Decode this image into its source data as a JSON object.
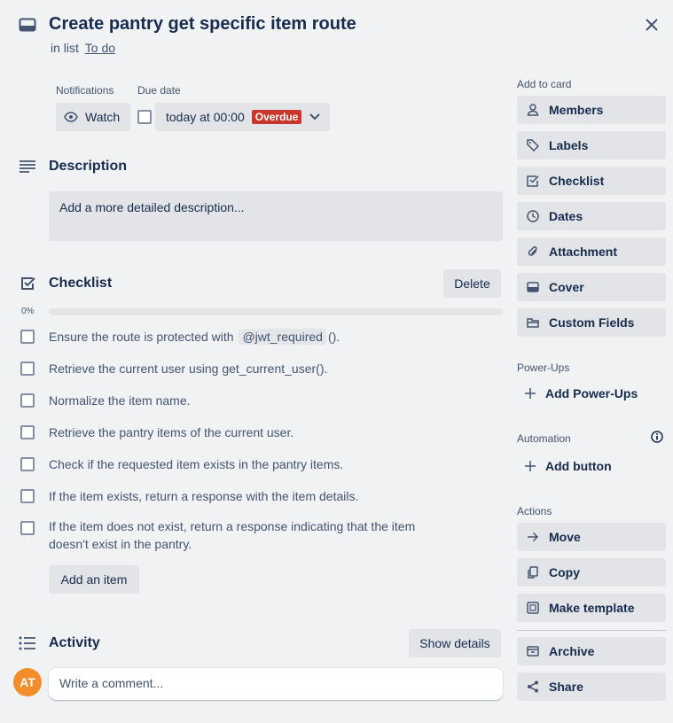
{
  "card": {
    "title": "Create pantry get specific item route",
    "in_list_prefix": "in list",
    "list_name": "To do"
  },
  "notifications": {
    "label": "Notifications",
    "watch_label": "Watch"
  },
  "due": {
    "label": "Due date",
    "value": "today at 00:00",
    "badge": "Overdue",
    "badge_color": "#c9372c"
  },
  "description": {
    "heading": "Description",
    "placeholder": "Add a more detailed description..."
  },
  "checklist": {
    "heading": "Checklist",
    "delete_label": "Delete",
    "progress_text": "0%",
    "progress": 0,
    "items": [
      {
        "before": "Ensure the route is protected with",
        "code": "@jwt_required",
        "after": "()."
      },
      {
        "text": "Retrieve the current user using get_current_user()."
      },
      {
        "text": "Normalize the item name."
      },
      {
        "text": "Retrieve the pantry items of the current user."
      },
      {
        "text": "Check if the requested item exists in the pantry items."
      },
      {
        "text": "If the item exists, return a response with the item details."
      },
      {
        "line1": "If the item does not exist, return a response indicating that the item",
        "line2": "doesn't exist in the pantry."
      }
    ],
    "add_item_label": "Add an item"
  },
  "activity": {
    "heading": "Activity",
    "show_details_label": "Show details",
    "avatar_initials": "AT",
    "avatar_color": "#f38c2b",
    "comment_placeholder": "Write a comment..."
  },
  "sidebar": {
    "add_to_card_label": "Add to card",
    "add_to_card": [
      {
        "label": "Members",
        "icon": "person-icon"
      },
      {
        "label": "Labels",
        "icon": "tag-icon"
      },
      {
        "label": "Checklist",
        "icon": "checklist-icon"
      },
      {
        "label": "Dates",
        "icon": "clock-icon"
      },
      {
        "label": "Attachment",
        "icon": "paperclip-icon"
      },
      {
        "label": "Cover",
        "icon": "cover-icon"
      },
      {
        "label": "Custom Fields",
        "icon": "custom-fields-icon"
      }
    ],
    "power_ups_label": "Power-Ups",
    "add_power_ups_label": "Add Power-Ups",
    "automation_label": "Automation",
    "add_button_label": "Add button",
    "actions_label": "Actions",
    "actions": [
      {
        "label": "Move",
        "icon": "arrow-right-icon"
      },
      {
        "label": "Copy",
        "icon": "copy-icon"
      },
      {
        "label": "Make template",
        "icon": "template-icon"
      },
      {
        "label": "Archive",
        "icon": "archive-icon"
      },
      {
        "label": "Share",
        "icon": "share-icon"
      }
    ]
  }
}
